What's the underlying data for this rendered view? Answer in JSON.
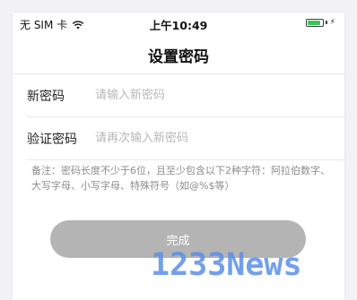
{
  "status_bar": {
    "carrier": "无 SIM 卡",
    "time": "上午10:49",
    "wifi_icon": "wifi-icon",
    "battery_icon": "battery-icon",
    "battery_level": 0.9,
    "battery_color": "#35c759"
  },
  "nav": {
    "title": "设置密码"
  },
  "form": {
    "new_password": {
      "label": "新密码",
      "placeholder": "请输入新密码",
      "value": ""
    },
    "confirm_password": {
      "label": "验证密码",
      "placeholder": "请再次输入新密码",
      "value": ""
    },
    "hint": "备注：密码长度不少于6位，且至少包含以下2种字符：阿拉伯数字、大写字母、小写字母、特殊符号（如@%$等）",
    "submit_label": "完成"
  },
  "watermark": "1233News",
  "colors": {
    "button_disabled": "#b4b4b4",
    "watermark": "#5b8fe8"
  }
}
